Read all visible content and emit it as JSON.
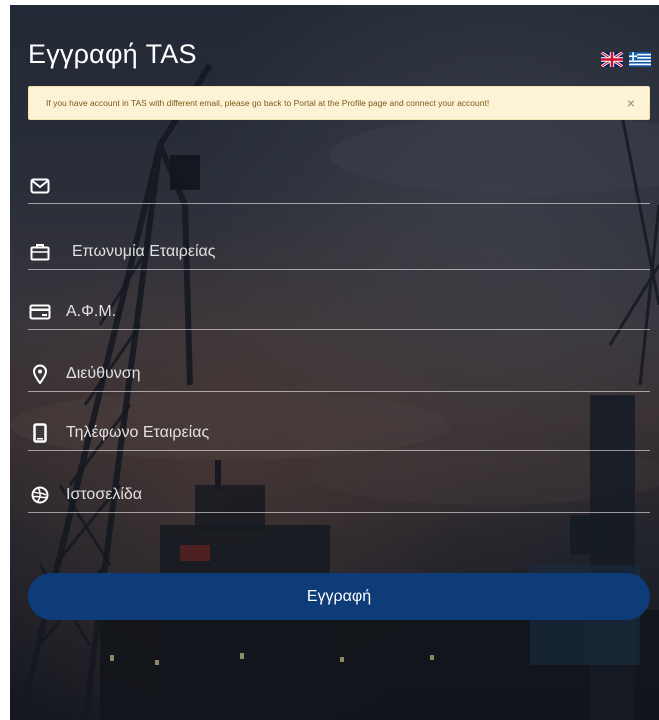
{
  "header": {
    "title": "Εγγραφή TAS"
  },
  "languages": [
    {
      "name": "English",
      "icon": "uk-flag-icon"
    },
    {
      "name": "Ελληνικά",
      "icon": "greek-flag-icon"
    }
  ],
  "alert": {
    "message": "If you have account in TAS with different email, please go back to Portal at the Profile page and connect your account!",
    "close_label": "×",
    "background": "#fcf3d6",
    "text_color": "#7a5a17"
  },
  "form": {
    "fields": [
      {
        "icon": "envelope-icon",
        "placeholder": "",
        "value": ""
      },
      {
        "icon": "briefcase-icon",
        "placeholder": "Επωνυμία Εταιρείας",
        "value": ""
      },
      {
        "icon": "credit-card-icon",
        "placeholder": "Α.Φ.Μ.",
        "value": ""
      },
      {
        "icon": "map-pin-icon",
        "placeholder": "Διεύθυνση",
        "value": ""
      },
      {
        "icon": "mobile-phone-icon",
        "placeholder": "Τηλέφωνο Εταιρείας",
        "value": ""
      },
      {
        "icon": "globe-icon",
        "placeholder": "Ιστοσελίδα",
        "value": ""
      }
    ],
    "submit_label": "Εγγραφή",
    "submit_color": "#0d3c78"
  }
}
